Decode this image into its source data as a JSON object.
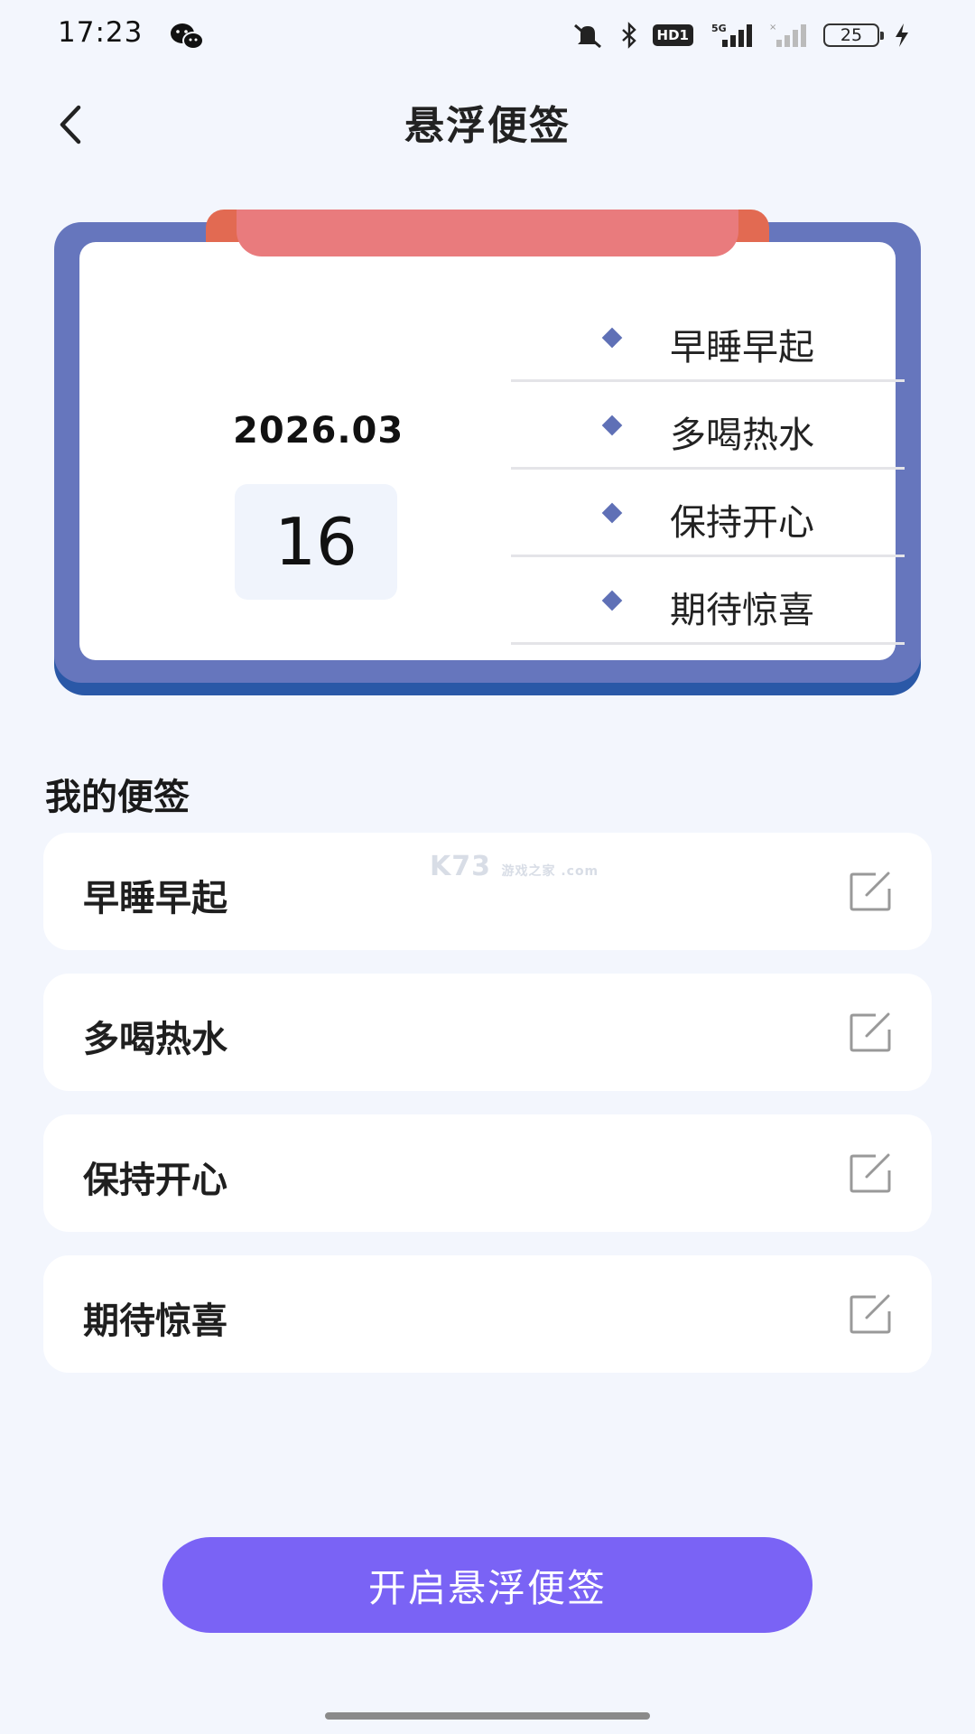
{
  "status_bar": {
    "time": "17:23",
    "icons": [
      "wechat-icon",
      "mute-icon",
      "bluetooth-icon",
      "hd-icon",
      "signal-5g-icon",
      "signal-icon",
      "battery-icon",
      "charging-icon"
    ],
    "hd_label": "HD1",
    "network_label": "5G",
    "battery_level": "25"
  },
  "header": {
    "back_icon": "chevron-left-icon",
    "title": "悬浮便签"
  },
  "card": {
    "year_month": "2026.03",
    "day": "16",
    "items": [
      {
        "text": "早睡早起"
      },
      {
        "text": "多喝热水"
      },
      {
        "text": "保持开心"
      },
      {
        "text": "期待惊喜"
      }
    ],
    "colors": {
      "frame": "#6676bd",
      "tab": "#e97b7d",
      "diamond": "#5f70b6"
    }
  },
  "section": {
    "title": "我的便签"
  },
  "notes": [
    {
      "label": "早睡早起",
      "icon": "edit-icon"
    },
    {
      "label": "多喝热水",
      "icon": "edit-icon"
    },
    {
      "label": "保持开心",
      "icon": "edit-icon"
    },
    {
      "label": "期待惊喜",
      "icon": "edit-icon"
    }
  ],
  "watermark": {
    "main": "K73",
    "sub": "游戏之家 .com"
  },
  "cta": {
    "label": "开启悬浮便签",
    "color": "#7a63f5"
  }
}
